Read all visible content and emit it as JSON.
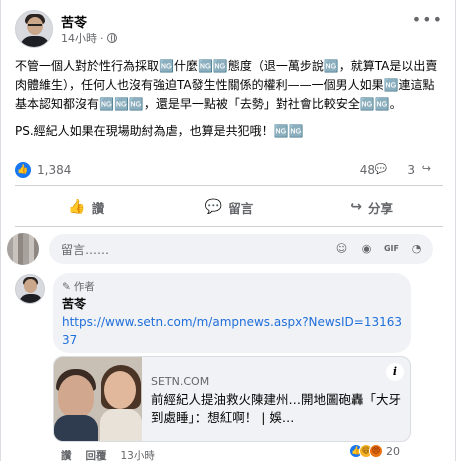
{
  "post": {
    "author": "苦苓",
    "time": "14小時",
    "separator": "·",
    "text_p1": "不管一個人對於性行為採取🆖什麼🆖🆖態度（退一萬步說🆖，就算TA是以出賣肉體維生），任何人也沒有強迫TA發生性關係的權利——一個男人如果🆖連這點基本認知都沒有🆖🆖🆖，還是早一點被「去勢」對社會比較安全🆖🆖。",
    "text_p2": "PS.經紀人如果在現場助紂為虐，也算是共犯哦！🆖🆖"
  },
  "stats": {
    "reactions": "1,384",
    "comments": "48",
    "shares": "3"
  },
  "actions": {
    "like": "讚",
    "comment": "留言",
    "share": "分享"
  },
  "composer": {
    "placeholder": "留言……"
  },
  "comment": {
    "badge": "作者",
    "author": "苦苓",
    "link": "https://www.setn.com/m/ampnews.aspx?NewsID=1316337",
    "preview_site": "SETN.COM",
    "preview_title": "前經紀人提油救火陳建州…開地圖砲轟「大牙到處睡」：想紅啊！ | 娛…",
    "like": "讚",
    "reply": "回覆",
    "time": "13小時",
    "reactions": "20"
  },
  "icons": {
    "globe": "globe-icon",
    "more": "more-horizontal-icon",
    "like": "thumbs-up-icon",
    "comment": "speech-bubble-icon",
    "share": "share-arrow-icon",
    "emoji": "smiley-icon",
    "camera": "camera-icon",
    "gif": "gif-icon",
    "sticker": "sticker-icon",
    "pencil": "pencil-icon",
    "info": "info-icon"
  },
  "colors": {
    "accent": "#1877f2",
    "link": "#216fdb",
    "secondary_text": "#65676b"
  }
}
